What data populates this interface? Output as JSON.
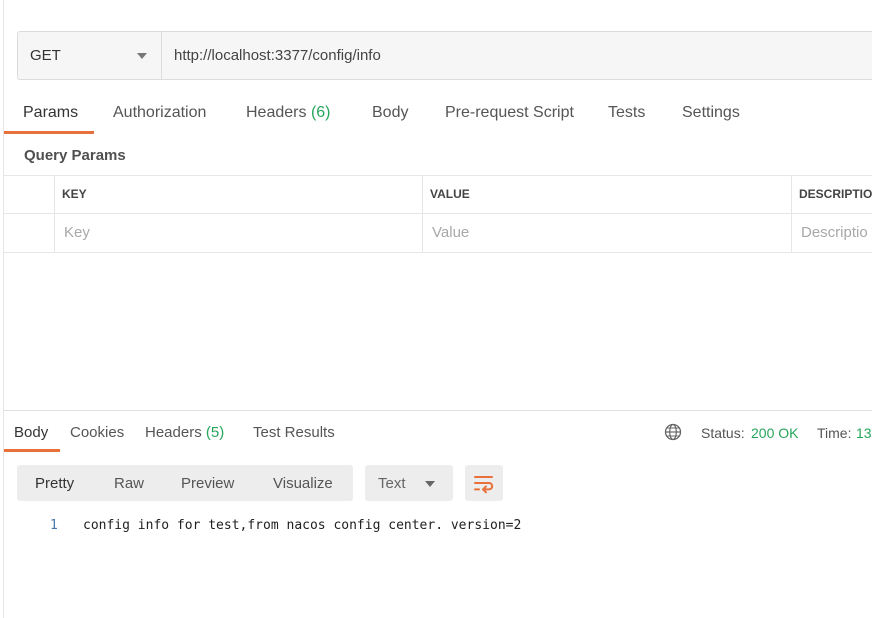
{
  "request": {
    "method": "GET",
    "url": "http://localhost:3377/config/info"
  },
  "request_tabs": [
    {
      "label": "Params",
      "active": true
    },
    {
      "label": "Authorization"
    },
    {
      "label": "Headers",
      "count": "(6)"
    },
    {
      "label": "Body"
    },
    {
      "label": "Pre-request Script"
    },
    {
      "label": "Tests"
    },
    {
      "label": "Settings"
    }
  ],
  "query_params": {
    "title": "Query Params",
    "columns": [
      "KEY",
      "VALUE",
      "DESCRIPTIO"
    ],
    "placeholders": {
      "key": "Key",
      "value": "Value",
      "description": "Descriptio"
    }
  },
  "response_tabs": [
    {
      "label": "Body",
      "active": true
    },
    {
      "label": "Cookies"
    },
    {
      "label": "Headers",
      "count": "(5)"
    },
    {
      "label": "Test Results"
    }
  ],
  "response_meta": {
    "status_label": "Status:",
    "status_value": "200 OK",
    "time_label": "Time:",
    "time_value": "13"
  },
  "view_modes": [
    "Pretty",
    "Raw",
    "Preview",
    "Visualize"
  ],
  "active_view_mode": "Pretty",
  "language": "Text",
  "response_body": {
    "lines": [
      {
        "num": "1",
        "text": "config info for test,from nacos config center. version=2"
      }
    ]
  },
  "colors": {
    "accent": "#e8703a",
    "status_green": "#26a65b",
    "line_number": "#4a76a8"
  },
  "icons": [
    "globe-icon",
    "wrap-lines-icon",
    "chevron-down-icon"
  ]
}
